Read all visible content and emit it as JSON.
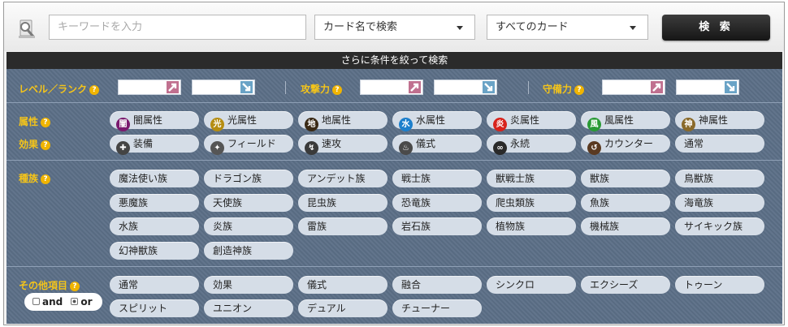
{
  "search": {
    "placeholder": "キーワードを入力",
    "mode_selected": "カード名で検索",
    "card_filter_selected": "すべてのカード",
    "button_label": "検 索"
  },
  "subbar_label": "さらに条件を絞って検索",
  "stats": {
    "level_label": "レベル／ランク",
    "attack_label": "攻撃力",
    "defense_label": "守備力"
  },
  "help_glyph": "?",
  "attribute": {
    "label": "属性",
    "items": [
      {
        "label": "闇属性",
        "icon": "dark-attribute-icon",
        "glyph": "闇",
        "color": "#7a1a6e"
      },
      {
        "label": "光属性",
        "icon": "light-attribute-icon",
        "glyph": "光",
        "color": "#b58d12"
      },
      {
        "label": "地属性",
        "icon": "earth-attribute-icon",
        "glyph": "地",
        "color": "#3a2a16"
      },
      {
        "label": "水属性",
        "icon": "water-attribute-icon",
        "glyph": "水",
        "color": "#1c7fcc"
      },
      {
        "label": "炎属性",
        "icon": "fire-attribute-icon",
        "glyph": "炎",
        "color": "#d8231c"
      },
      {
        "label": "風属性",
        "icon": "wind-attribute-icon",
        "glyph": "風",
        "color": "#2a9a35"
      },
      {
        "label": "神属性",
        "icon": "divine-attribute-icon",
        "glyph": "神",
        "color": "#8a6a2a"
      }
    ]
  },
  "effect": {
    "label": "効果",
    "items": [
      {
        "label": "装備",
        "icon": "equip-icon",
        "glyph": "✚",
        "color": "#444444"
      },
      {
        "label": "フィールド",
        "icon": "field-icon",
        "glyph": "✦",
        "color": "#555555"
      },
      {
        "label": "速攻",
        "icon": "quick-play-icon",
        "glyph": "↯",
        "color": "#3a3a3a"
      },
      {
        "label": "儀式",
        "icon": "ritual-icon",
        "glyph": "♨",
        "color": "#4a4a4a"
      },
      {
        "label": "永続",
        "icon": "continuous-icon",
        "glyph": "∞",
        "color": "#2a2a2a"
      },
      {
        "label": "カウンター",
        "icon": "counter-icon",
        "glyph": "↺",
        "color": "#5a3a22"
      },
      {
        "label": "通常",
        "icon": "",
        "glyph": "",
        "color": ""
      }
    ]
  },
  "type": {
    "label": "種族",
    "items": [
      "魔法使い族",
      "ドラゴン族",
      "アンデット族",
      "戦士族",
      "獣戦士族",
      "獣族",
      "鳥獣族",
      "悪魔族",
      "天使族",
      "昆虫族",
      "恐竜族",
      "爬虫類族",
      "魚族",
      "海竜族",
      "水族",
      "炎族",
      "雷族",
      "岩石族",
      "植物族",
      "機械族",
      "サイキック族",
      "幻神獣族",
      "創造神族"
    ]
  },
  "other": {
    "label": "その他項目",
    "items": [
      "通常",
      "効果",
      "儀式",
      "融合",
      "シンクロ",
      "エクシーズ",
      "トゥーン",
      "スピリット",
      "ユニオン",
      "デュアル",
      "チューナー"
    ]
  },
  "logic": {
    "and_label": "and",
    "or_label": "or",
    "selected": "or"
  },
  "colors": {
    "panel": "#5c6f87",
    "label": "#f4c41a",
    "pill": "#d5dde7",
    "arrow_up": "#c0708f",
    "arrow_down": "#6aa3c6"
  }
}
